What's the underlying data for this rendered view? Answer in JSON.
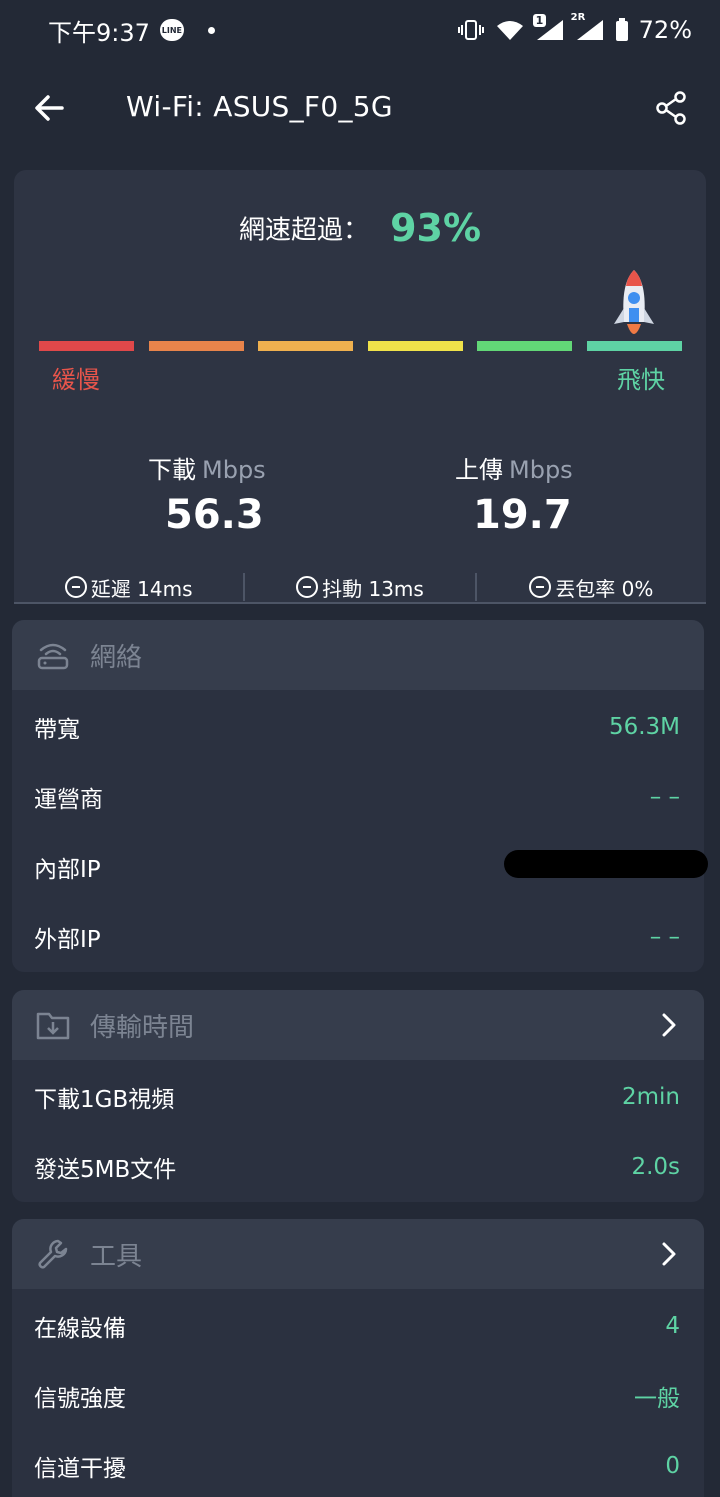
{
  "status_bar": {
    "time": "下午9:37",
    "notification_badge": "LINE",
    "sim_badge_1": "1",
    "sim_badge_2": "2R",
    "battery": "72%"
  },
  "app_bar": {
    "title": "Wi-Fi: ASUS_F0_5G",
    "back_icon": "arrow-left-icon",
    "share_icon": "share-icon"
  },
  "speed_summary": {
    "label": "網速超過：",
    "percent": "93%",
    "percent_value": 93,
    "slow_label": "緩慢",
    "fast_label": "飛快",
    "scale_colors": [
      "#e0484a",
      "#e8844b",
      "#efb04f",
      "#f0e24a",
      "#62d777",
      "#5ed3a4"
    ]
  },
  "download": {
    "label": "下載",
    "unit": "Mbps",
    "value": "56.3"
  },
  "upload": {
    "label": "上傳",
    "unit": "Mbps",
    "value": "19.7"
  },
  "stats": [
    {
      "icon": "latency-icon",
      "text": "延遲 14ms"
    },
    {
      "icon": "jitter-icon",
      "text": "抖動 13ms"
    },
    {
      "icon": "packet-loss-icon",
      "text": "丟包率 0%"
    }
  ],
  "network": {
    "title": "網絡",
    "icon": "router-icon",
    "rows": [
      {
        "label": "帶寬",
        "value": "56.3M"
      },
      {
        "label": "運營商",
        "value": "– –"
      },
      {
        "label": "內部IP",
        "value": ""
      },
      {
        "label": "外部IP",
        "value": "– –"
      }
    ]
  },
  "transfer": {
    "title": "傳輸時間",
    "icon": "folder-download-icon",
    "rows": [
      {
        "label": "下載1GB視頻",
        "value": "2min"
      },
      {
        "label": "發送5MB文件",
        "value": "2.0s"
      }
    ]
  },
  "tools": {
    "title": "工具",
    "icon": "wrench-icon",
    "rows": [
      {
        "label": "在線設備",
        "value": "4"
      },
      {
        "label": "信號強度",
        "value": "一般"
      },
      {
        "label": "信道干擾",
        "value": "0"
      }
    ]
  },
  "accent_color": "#5ed3a4"
}
